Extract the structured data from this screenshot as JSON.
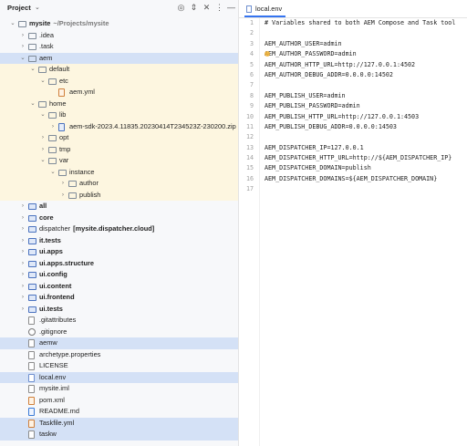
{
  "project": {
    "title": "Project",
    "chevron": "⌄",
    "toolbar_icons": [
      "target-icon",
      "collapse-all-icon",
      "expand-all-icon",
      "more-icon",
      "minimize-icon"
    ]
  },
  "tree": [
    {
      "label": "mysite",
      "sub": "~/Projects/mysite",
      "depth": 0,
      "arrow": "v",
      "icon": "folder",
      "bold": true,
      "bg": ""
    },
    {
      "label": ".idea",
      "depth": 1,
      "arrow": ">",
      "icon": "folder",
      "bg": ""
    },
    {
      "label": ".task",
      "depth": 1,
      "arrow": ">",
      "icon": "folder",
      "bg": ""
    },
    {
      "label": "aem",
      "depth": 1,
      "arrow": "v",
      "icon": "folder",
      "bg": "sel"
    },
    {
      "label": "default",
      "depth": 2,
      "arrow": "v",
      "icon": "folder",
      "bg": "yel"
    },
    {
      "label": "etc",
      "depth": 3,
      "arrow": "v",
      "icon": "folder",
      "bg": "yel"
    },
    {
      "label": "aem.yml",
      "depth": 4,
      "arrow": "",
      "icon": "yml",
      "bg": "yel"
    },
    {
      "label": "home",
      "depth": 2,
      "arrow": "v",
      "icon": "folder",
      "bg": "yel"
    },
    {
      "label": "lib",
      "depth": 3,
      "arrow": "v",
      "icon": "folder",
      "bg": "yel"
    },
    {
      "label": "aem-sdk-2023.4.11835.20230414T234523Z-230200.zip",
      "depth": 4,
      "arrow": ">",
      "icon": "zip",
      "bg": "yel"
    },
    {
      "label": "opt",
      "depth": 3,
      "arrow": ">",
      "icon": "folder",
      "bg": "yel"
    },
    {
      "label": "tmp",
      "depth": 3,
      "arrow": ">",
      "icon": "folder",
      "bg": "yel"
    },
    {
      "label": "var",
      "depth": 3,
      "arrow": "v",
      "icon": "folder",
      "bg": "yel"
    },
    {
      "label": "instance",
      "depth": 4,
      "arrow": "v",
      "icon": "folder",
      "bg": "yel"
    },
    {
      "label": "author",
      "depth": 5,
      "arrow": ">",
      "icon": "folder",
      "bg": "yel"
    },
    {
      "label": "publish",
      "depth": 5,
      "arrow": ">",
      "icon": "folder",
      "bg": "yel"
    },
    {
      "label": "all",
      "depth": 1,
      "arrow": ">",
      "icon": "folder-mod",
      "bold": true,
      "bg": ""
    },
    {
      "label": "core",
      "depth": 1,
      "arrow": ">",
      "icon": "folder-mod",
      "bold": true,
      "bg": ""
    },
    {
      "label": "dispatcher",
      "extra": "[mysite.dispatcher.cloud]",
      "depth": 1,
      "arrow": ">",
      "icon": "folder-mod",
      "bg": ""
    },
    {
      "label": "it.tests",
      "depth": 1,
      "arrow": ">",
      "icon": "folder-mod",
      "bold": true,
      "bg": ""
    },
    {
      "label": "ui.apps",
      "depth": 1,
      "arrow": ">",
      "icon": "folder-mod",
      "bold": true,
      "bg": ""
    },
    {
      "label": "ui.apps.structure",
      "depth": 1,
      "arrow": ">",
      "icon": "folder-mod",
      "bold": true,
      "bg": ""
    },
    {
      "label": "ui.config",
      "depth": 1,
      "arrow": ">",
      "icon": "folder-mod",
      "bold": true,
      "bg": ""
    },
    {
      "label": "ui.content",
      "depth": 1,
      "arrow": ">",
      "icon": "folder-mod",
      "bold": true,
      "bg": ""
    },
    {
      "label": "ui.frontend",
      "depth": 1,
      "arrow": ">",
      "icon": "folder-mod",
      "bold": true,
      "bg": ""
    },
    {
      "label": "ui.tests",
      "depth": 1,
      "arrow": ">",
      "icon": "folder-mod",
      "bold": true,
      "bg": ""
    },
    {
      "label": ".gitattributes",
      "depth": 1,
      "arrow": "",
      "icon": "file",
      "bg": ""
    },
    {
      "label": ".gitignore",
      "depth": 1,
      "arrow": "",
      "icon": "ignore",
      "bg": ""
    },
    {
      "label": "aemw",
      "depth": 1,
      "arrow": "",
      "icon": "file",
      "bg": "sel"
    },
    {
      "label": "archetype.properties",
      "depth": 1,
      "arrow": "",
      "icon": "file",
      "bg": ""
    },
    {
      "label": "LICENSE",
      "depth": 1,
      "arrow": "",
      "icon": "file",
      "bg": ""
    },
    {
      "label": "local.env",
      "depth": 1,
      "arrow": "",
      "icon": "env",
      "bg": "sel"
    },
    {
      "label": "mysite.iml",
      "depth": 1,
      "arrow": "",
      "icon": "file",
      "bg": ""
    },
    {
      "label": "pom.xml",
      "depth": 1,
      "arrow": "",
      "icon": "xml",
      "bg": ""
    },
    {
      "label": "README.md",
      "depth": 1,
      "arrow": "",
      "icon": "md",
      "bg": ""
    },
    {
      "label": "Taskfile.yml",
      "depth": 1,
      "arrow": "",
      "icon": "yml",
      "bg": "sel"
    },
    {
      "label": "taskw",
      "depth": 1,
      "arrow": "",
      "icon": "file",
      "bg": "sel"
    }
  ],
  "editor": {
    "tab_label": "local.env",
    "lines": [
      "# Variables shared to both AEM Compose and Task tool",
      "",
      "AEM_AUTHOR_USER=admin",
      "AEM_AUTHOR_PASSWORD=admin",
      "AEM_AUTHOR_HTTP_URL=http://127.0.0.1:4502",
      "AEM_AUTHOR_DEBUG_ADDR=0.0.0.0:14502",
      "",
      "AEM_PUBLISH_USER=admin",
      "AEM_PUBLISH_PASSWORD=admin",
      "AEM_PUBLISH_HTTP_URL=http://127.0.0.1:4503",
      "AEM_PUBLISH_DEBUG_ADDR=0.0.0.0:14503",
      "",
      "AEM_DISPATCHER_IP=127.0.0.1",
      "AEM_DISPATCHER_HTTP_URL=http://${AEM_DISPATCHER_IP}",
      "AEM_DISPATCHER_DOMAIN=publish",
      "AEM_DISPATCHER_DOMAINS=${AEM_DISPATCHER_DOMAIN}",
      ""
    ]
  }
}
